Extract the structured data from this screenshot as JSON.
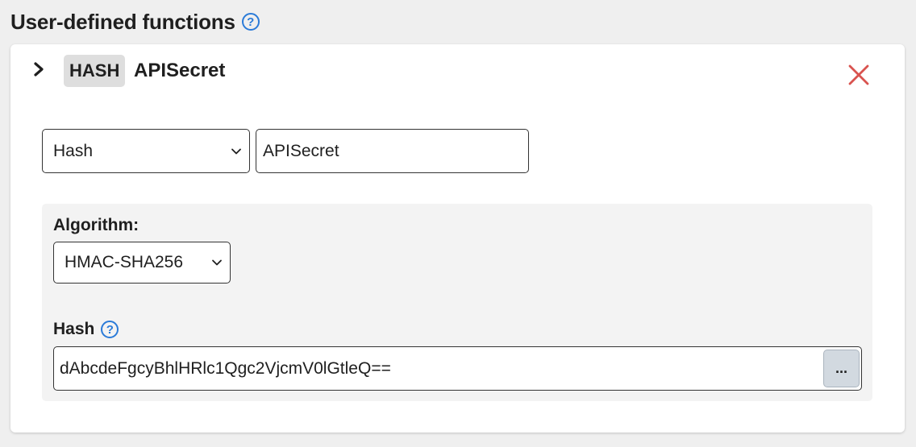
{
  "section": {
    "title": "User-defined functions",
    "help_icon": "?"
  },
  "function": {
    "type_badge": "HASH",
    "name": "APISecret",
    "expand_icon": "chevron-right-icon",
    "remove_icon": "close-icon",
    "remove_color": "#d9534f",
    "type_select": {
      "value": "Hash"
    },
    "name_input": {
      "value": "APISecret"
    },
    "params": {
      "algorithm": {
        "label": "Algorithm:",
        "value": "HMAC-SHA256"
      },
      "hash": {
        "label": "Hash",
        "help_icon": "?",
        "value": "dAbcdeFgcyBhlHRlc1Qgc2VjcmV0lGtleQ==",
        "more_label": "..."
      }
    }
  },
  "colors": {
    "accent": "#2b7bd8",
    "badge_bg": "#dedede",
    "panel_bg": "#f3f3f3",
    "button_bg": "#d2d9e0"
  }
}
